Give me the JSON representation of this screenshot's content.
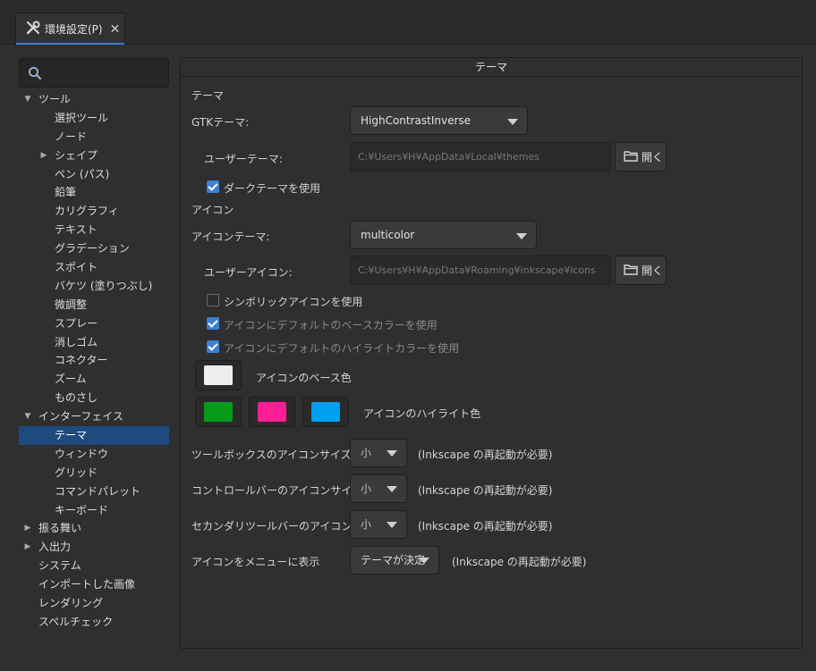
{
  "tab": {
    "label": "環境設定(P)",
    "close": "✕"
  },
  "sidebar": {
    "items": [
      {
        "label": "ツール",
        "level": 0,
        "expander": "open"
      },
      {
        "label": "選択ツール",
        "level": 1
      },
      {
        "label": "ノード",
        "level": 1
      },
      {
        "label": "シェイプ",
        "level": 1,
        "expander": "closed"
      },
      {
        "label": "ペン (パス)",
        "level": 1
      },
      {
        "label": "鉛筆",
        "level": 1
      },
      {
        "label": "カリグラフィ",
        "level": 1
      },
      {
        "label": "テキスト",
        "level": 1
      },
      {
        "label": "グラデーション",
        "level": 1
      },
      {
        "label": "スポイト",
        "level": 1
      },
      {
        "label": "バケツ (塗りつぶし)",
        "level": 1
      },
      {
        "label": "微調整",
        "level": 1
      },
      {
        "label": "スプレー",
        "level": 1
      },
      {
        "label": "消しゴム",
        "level": 1
      },
      {
        "label": "コネクター",
        "level": 1
      },
      {
        "label": "ズーム",
        "level": 1
      },
      {
        "label": "ものさし",
        "level": 1
      },
      {
        "label": "インターフェイス",
        "level": 0,
        "expander": "open"
      },
      {
        "label": "テーマ",
        "level": 1,
        "selected": true
      },
      {
        "label": "ウィンドウ",
        "level": 1
      },
      {
        "label": "グリッド",
        "level": 1
      },
      {
        "label": "コマンドパレット",
        "level": 1
      },
      {
        "label": "キーボード",
        "level": 1
      },
      {
        "label": "振る舞い",
        "level": 0,
        "expander": "closed"
      },
      {
        "label": "入出力",
        "level": 0,
        "expander": "closed"
      },
      {
        "label": "システム",
        "level": 0
      },
      {
        "label": "インポートした画像",
        "level": 0
      },
      {
        "label": "レンダリング",
        "level": 0
      },
      {
        "label": "スペルチェック",
        "level": 0
      }
    ]
  },
  "panel": {
    "title": "テーマ",
    "theme_section": "テーマ",
    "gtk_theme_label": "GTKテーマ:",
    "gtk_theme_value": "HighContrastInverse",
    "user_theme_label": "ユーザーテーマ:",
    "user_theme_path": "C:¥Users¥H¥AppData¥Local¥themes",
    "open_label": "開く",
    "dark_theme_label": "ダークテーマを使用",
    "icon_section": "アイコン",
    "icon_theme_label": "アイコンテーマ:",
    "icon_theme_value": "multicolor",
    "user_icon_label": "ユーザーアイコン:",
    "user_icon_path": "C:¥Users¥H¥AppData¥Roaming¥inkscape¥icons",
    "symbolic_label": "シンボリックアイコンを使用",
    "default_base_label": "アイコンにデフォルトのベースカラーを使用",
    "default_highlight_label": "アイコンにデフォルトのハイライトカラーを使用",
    "base_color_label": "アイコンのベース色",
    "highlight_color_label": "アイコンのハイライト色",
    "toolbox_size_label": "ツールボックスのアイコンサイズ:",
    "controlbar_size_label": "コントロールバーのアイコンサイズ:",
    "secondary_size_label": "セカンダリツールバーのアイコンサイズ:",
    "size_value": "小",
    "restart_note": "(Inkscape の再起動が必要)",
    "menu_icons_label": "アイコンをメニューに表示",
    "menu_icons_value": "テーマが決定"
  },
  "colors": {
    "base": "#eeeeee",
    "highlight_1": "#0a9a1a",
    "highlight_2": "#ff1e96",
    "highlight_3": "#00a0f0",
    "accent": "#3c7fd4"
  }
}
